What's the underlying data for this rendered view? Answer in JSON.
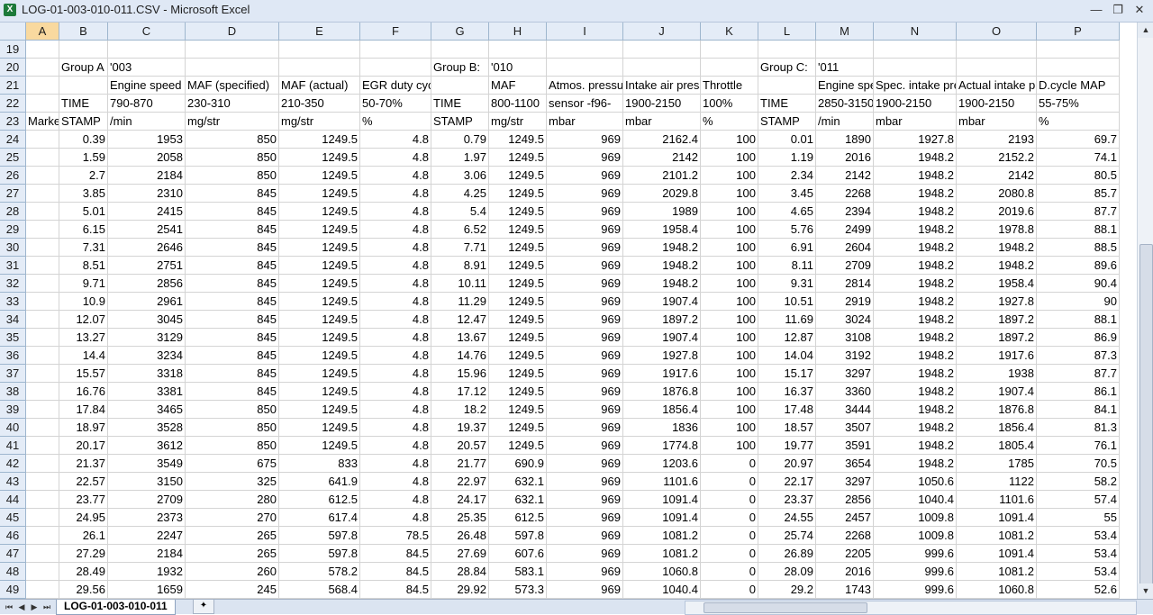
{
  "window": {
    "title": "LOG-01-003-010-011.CSV - Microsoft Excel",
    "app_icon": "excel-icon",
    "app_icon_glyph": "X",
    "min": "—",
    "restore": "❐",
    "close": "✕"
  },
  "columns": [
    "A",
    "B",
    "C",
    "D",
    "E",
    "F",
    "G",
    "H",
    "I",
    "J",
    "K",
    "L",
    "M",
    "N",
    "O",
    "P"
  ],
  "selected_column": "A",
  "rows": [
    {
      "n": "19",
      "c": [
        "",
        "",
        "",
        "",
        "",
        "",
        "",
        "",
        "",
        "",
        "",
        "",
        "",
        "",
        "",
        ""
      ]
    },
    {
      "n": "20",
      "c": [
        "",
        "Group A",
        "'003",
        "",
        "",
        "",
        "Group B:",
        "'010",
        "",
        "",
        "",
        "Group C:",
        "'011",
        "",
        "",
        ""
      ]
    },
    {
      "n": "21",
      "c": [
        "",
        "",
        "Engine speed",
        "MAF (specified)",
        "MAF (actual)",
        "EGR duty cycle",
        "",
        "MAF",
        "Atmos. pressure",
        "Intake air pressure",
        "Throttle",
        "",
        "Engine speed",
        "Spec. intake pressure",
        "Actual intake pressure",
        "D.cycle MAP"
      ]
    },
    {
      "n": "22",
      "c": [
        "",
        "TIME",
        "790-870",
        "230-310",
        "210-350",
        "50-70%",
        "TIME",
        "800-1100",
        "sensor -f96-",
        "1900-2150",
        "100%",
        "TIME",
        "2850-3150",
        "1900-2150",
        "1900-2150",
        "55-75%"
      ]
    },
    {
      "n": "23",
      "c": [
        "Marker",
        "STAMP",
        "/min",
        "mg/str",
        "mg/str",
        "%",
        "STAMP",
        "mg/str",
        "mbar",
        "mbar",
        "%",
        "STAMP",
        "/min",
        "mbar",
        "mbar",
        "%"
      ]
    },
    {
      "n": "24",
      "c": [
        "",
        "0.39",
        "1953",
        "850",
        "1249.5",
        "4.8",
        "0.79",
        "1249.5",
        "969",
        "2162.4",
        "100",
        "0.01",
        "1890",
        "1927.8",
        "2193",
        "69.7"
      ]
    },
    {
      "n": "25",
      "c": [
        "",
        "1.59",
        "2058",
        "850",
        "1249.5",
        "4.8",
        "1.97",
        "1249.5",
        "969",
        "2142",
        "100",
        "1.19",
        "2016",
        "1948.2",
        "2152.2",
        "74.1"
      ]
    },
    {
      "n": "26",
      "c": [
        "",
        "2.7",
        "2184",
        "850",
        "1249.5",
        "4.8",
        "3.06",
        "1249.5",
        "969",
        "2101.2",
        "100",
        "2.34",
        "2142",
        "1948.2",
        "2142",
        "80.5"
      ]
    },
    {
      "n": "27",
      "c": [
        "",
        "3.85",
        "2310",
        "845",
        "1249.5",
        "4.8",
        "4.25",
        "1249.5",
        "969",
        "2029.8",
        "100",
        "3.45",
        "2268",
        "1948.2",
        "2080.8",
        "85.7"
      ]
    },
    {
      "n": "28",
      "c": [
        "",
        "5.01",
        "2415",
        "845",
        "1249.5",
        "4.8",
        "5.4",
        "1249.5",
        "969",
        "1989",
        "100",
        "4.65",
        "2394",
        "1948.2",
        "2019.6",
        "87.7"
      ]
    },
    {
      "n": "29",
      "c": [
        "",
        "6.15",
        "2541",
        "845",
        "1249.5",
        "4.8",
        "6.52",
        "1249.5",
        "969",
        "1958.4",
        "100",
        "5.76",
        "2499",
        "1948.2",
        "1978.8",
        "88.1"
      ]
    },
    {
      "n": "30",
      "c": [
        "",
        "7.31",
        "2646",
        "845",
        "1249.5",
        "4.8",
        "7.71",
        "1249.5",
        "969",
        "1948.2",
        "100",
        "6.91",
        "2604",
        "1948.2",
        "1948.2",
        "88.5"
      ]
    },
    {
      "n": "31",
      "c": [
        "",
        "8.51",
        "2751",
        "845",
        "1249.5",
        "4.8",
        "8.91",
        "1249.5",
        "969",
        "1948.2",
        "100",
        "8.11",
        "2709",
        "1948.2",
        "1948.2",
        "89.6"
      ]
    },
    {
      "n": "32",
      "c": [
        "",
        "9.71",
        "2856",
        "845",
        "1249.5",
        "4.8",
        "10.11",
        "1249.5",
        "969",
        "1948.2",
        "100",
        "9.31",
        "2814",
        "1948.2",
        "1958.4",
        "90.4"
      ]
    },
    {
      "n": "33",
      "c": [
        "",
        "10.9",
        "2961",
        "845",
        "1249.5",
        "4.8",
        "11.29",
        "1249.5",
        "969",
        "1907.4",
        "100",
        "10.51",
        "2919",
        "1948.2",
        "1927.8",
        "90"
      ]
    },
    {
      "n": "34",
      "c": [
        "",
        "12.07",
        "3045",
        "845",
        "1249.5",
        "4.8",
        "12.47",
        "1249.5",
        "969",
        "1897.2",
        "100",
        "11.69",
        "3024",
        "1948.2",
        "1897.2",
        "88.1"
      ]
    },
    {
      "n": "35",
      "c": [
        "",
        "13.27",
        "3129",
        "845",
        "1249.5",
        "4.8",
        "13.67",
        "1249.5",
        "969",
        "1907.4",
        "100",
        "12.87",
        "3108",
        "1948.2",
        "1897.2",
        "86.9"
      ]
    },
    {
      "n": "36",
      "c": [
        "",
        "14.4",
        "3234",
        "845",
        "1249.5",
        "4.8",
        "14.76",
        "1249.5",
        "969",
        "1927.8",
        "100",
        "14.04",
        "3192",
        "1948.2",
        "1917.6",
        "87.3"
      ]
    },
    {
      "n": "37",
      "c": [
        "",
        "15.57",
        "3318",
        "845",
        "1249.5",
        "4.8",
        "15.96",
        "1249.5",
        "969",
        "1917.6",
        "100",
        "15.17",
        "3297",
        "1948.2",
        "1938",
        "87.7"
      ]
    },
    {
      "n": "38",
      "c": [
        "",
        "16.76",
        "3381",
        "845",
        "1249.5",
        "4.8",
        "17.12",
        "1249.5",
        "969",
        "1876.8",
        "100",
        "16.37",
        "3360",
        "1948.2",
        "1907.4",
        "86.1"
      ]
    },
    {
      "n": "39",
      "c": [
        "",
        "17.84",
        "3465",
        "850",
        "1249.5",
        "4.8",
        "18.2",
        "1249.5",
        "969",
        "1856.4",
        "100",
        "17.48",
        "3444",
        "1948.2",
        "1876.8",
        "84.1"
      ]
    },
    {
      "n": "40",
      "c": [
        "",
        "18.97",
        "3528",
        "850",
        "1249.5",
        "4.8",
        "19.37",
        "1249.5",
        "969",
        "1836",
        "100",
        "18.57",
        "3507",
        "1948.2",
        "1856.4",
        "81.3"
      ]
    },
    {
      "n": "41",
      "c": [
        "",
        "20.17",
        "3612",
        "850",
        "1249.5",
        "4.8",
        "20.57",
        "1249.5",
        "969",
        "1774.8",
        "100",
        "19.77",
        "3591",
        "1948.2",
        "1805.4",
        "76.1"
      ]
    },
    {
      "n": "42",
      "c": [
        "",
        "21.37",
        "3549",
        "675",
        "833",
        "4.8",
        "21.77",
        "690.9",
        "969",
        "1203.6",
        "0",
        "20.97",
        "3654",
        "1948.2",
        "1785",
        "70.5"
      ]
    },
    {
      "n": "43",
      "c": [
        "",
        "22.57",
        "3150",
        "325",
        "641.9",
        "4.8",
        "22.97",
        "632.1",
        "969",
        "1101.6",
        "0",
        "22.17",
        "3297",
        "1050.6",
        "1122",
        "58.2"
      ]
    },
    {
      "n": "44",
      "c": [
        "",
        "23.77",
        "2709",
        "280",
        "612.5",
        "4.8",
        "24.17",
        "632.1",
        "969",
        "1091.4",
        "0",
        "23.37",
        "2856",
        "1040.4",
        "1101.6",
        "57.4"
      ]
    },
    {
      "n": "45",
      "c": [
        "",
        "24.95",
        "2373",
        "270",
        "617.4",
        "4.8",
        "25.35",
        "612.5",
        "969",
        "1091.4",
        "0",
        "24.55",
        "2457",
        "1009.8",
        "1091.4",
        "55"
      ]
    },
    {
      "n": "46",
      "c": [
        "",
        "26.1",
        "2247",
        "265",
        "597.8",
        "78.5",
        "26.48",
        "597.8",
        "969",
        "1081.2",
        "0",
        "25.74",
        "2268",
        "1009.8",
        "1081.2",
        "53.4"
      ]
    },
    {
      "n": "47",
      "c": [
        "",
        "27.29",
        "2184",
        "265",
        "597.8",
        "84.5",
        "27.69",
        "607.6",
        "969",
        "1081.2",
        "0",
        "26.89",
        "2205",
        "999.6",
        "1091.4",
        "53.4"
      ]
    },
    {
      "n": "48",
      "c": [
        "",
        "28.49",
        "1932",
        "260",
        "578.2",
        "84.5",
        "28.84",
        "583.1",
        "969",
        "1060.8",
        "0",
        "28.09",
        "2016",
        "999.6",
        "1081.2",
        "53.4"
      ]
    },
    {
      "n": "49",
      "c": [
        "",
        "29.56",
        "1659",
        "245",
        "568.4",
        "84.5",
        "29.92",
        "573.3",
        "969",
        "1040.4",
        "0",
        "29.2",
        "1743",
        "999.6",
        "1060.8",
        "52.6"
      ]
    }
  ],
  "tabs": {
    "sheet_name": "LOG-01-003-010-011",
    "nav_first": "⏮",
    "nav_prev": "◀",
    "nav_next": "▶",
    "nav_last": "⏭",
    "insert_icon": "insert-sheet-icon",
    "insert_glyph": "✦"
  },
  "scroll": {
    "up": "▲",
    "down": "▼"
  }
}
